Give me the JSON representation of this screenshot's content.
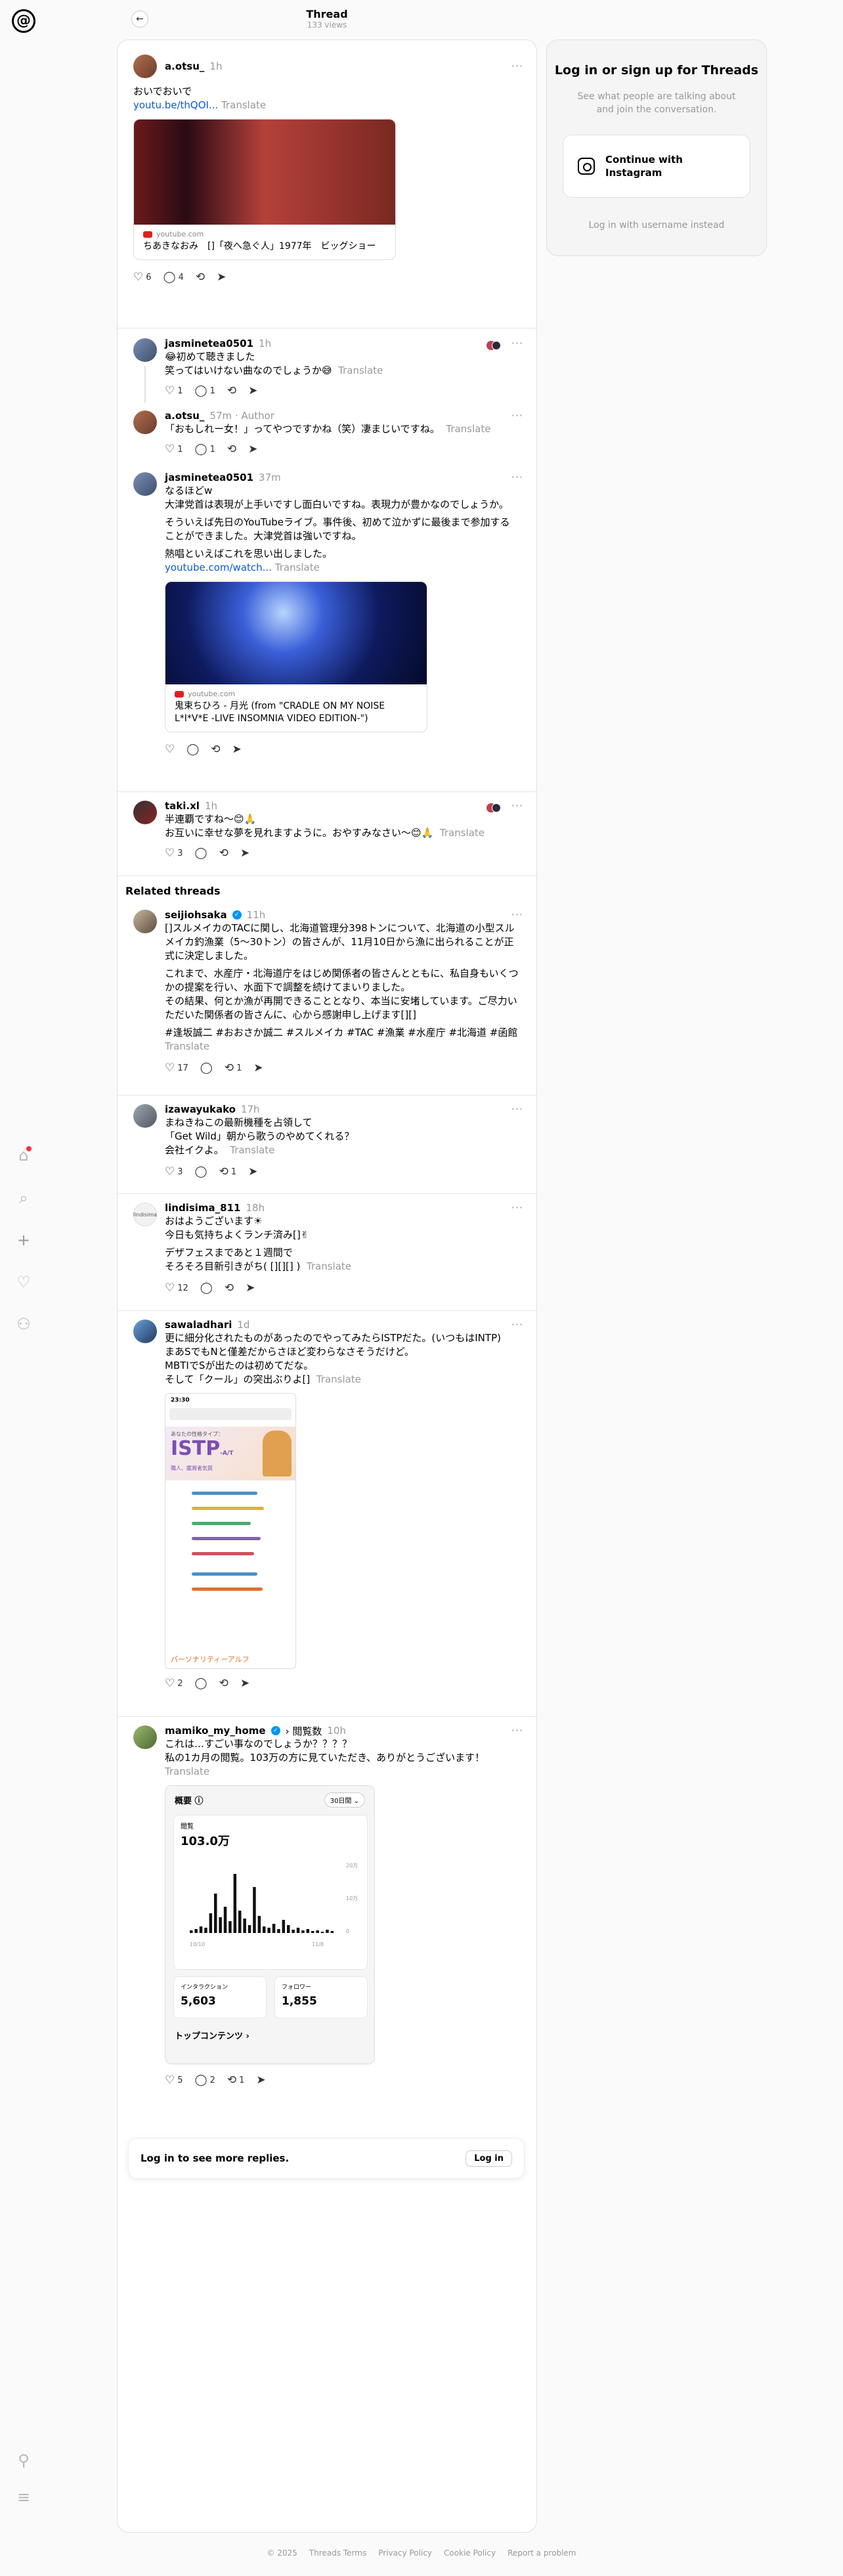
{
  "header": {
    "title": "Thread",
    "views": "133 views"
  },
  "nav": {
    "icons": [
      "home-icon",
      "search-icon",
      "create-icon",
      "heart-icon",
      "profile-icon",
      "pin-icon",
      "menu-icon"
    ]
  },
  "main_post": {
    "author": "a.otsu_",
    "time": "1h",
    "text": "おいでおいで",
    "link": "youtu.be/thQOI...",
    "translate": "Translate",
    "media": {
      "source": "youtube.com",
      "title": "ちあきなおみ　[]「夜へ急ぐ人」1977年　ビッグショー"
    },
    "likes": "6",
    "comments": "4"
  },
  "replies": [
    {
      "author": "jasminetea0501",
      "time": "1h",
      "text": "😂初めて聴きました\n笑ってはいけない曲なのでしょうか😅",
      "translate": "Translate",
      "likes": "1",
      "comments": "1"
    },
    {
      "author": "a.otsu_",
      "time": "57m",
      "tag": "· Author",
      "text": "「おもしれー女！」ってやつですかね（笑）凄まじいですね。",
      "translate": "Translate",
      "likes": "1",
      "comments": "1"
    },
    {
      "author": "jasminetea0501",
      "time": "37m",
      "p1": "なるほどw\n大津党首は表現が上手いですし面白いですね。表現力が豊かなのでしょうか。",
      "p2": "そういえば先日のYouTubeライブ。事件後、初めて泣かずに最後まで参加することができました。大津党首は強いですね。",
      "p3": "熱唱といえばこれを思い出しました。",
      "link": "youtube.com/watch...",
      "translate": "Translate",
      "media": {
        "source": "youtube.com",
        "title": "鬼束ちひろ - 月光 (from \"CRADLE ON MY NOISE L*I*V*E -LIVE INSOMNIA VIDEO EDITION-\")"
      }
    },
    {
      "author": "taki.xl",
      "time": "1h",
      "text": "半連覇ですね〜😊🙏\nお互いに幸せな夢を見れますように。おやすみなさい〜😊🙏",
      "translate": "Translate",
      "likes": "3"
    }
  ],
  "related": {
    "heading": "Related threads",
    "posts": [
      {
        "author": "seijiohsaka",
        "time": "11h",
        "p1": "[]スルメイカのTACに関し、北海道管理分398トンについて、北海道の小型スルメイカ釣漁業（5〜30トン）の皆さんが、11月10日から漁に出られることが正式に決定しました。",
        "p2": "これまで、水産庁・北海道庁をはじめ関係者の皆さんとともに、私自身もいくつかの提案を行い、水面下で調整を続けてまいりました。\nその結果、何とか漁が再開できることとなり、本当に安堵しています。ご尽力いただいた関係者の皆さんに、心から感謝申し上げます[][]",
        "p3": "#逢坂誠二 #おおさか誠二 #スルメイカ #TAC #漁業 #水産庁 #北海道 #函館",
        "translate": "Translate",
        "likes": "17",
        "reposts": "1"
      },
      {
        "author": "izawayukako",
        "time": "17h",
        "text": "まねきねこの最新機種を占領して\n「Get Wild」朝から歌うのやめてくれる？\n会社イクよ。",
        "translate": "Translate",
        "likes": "3",
        "reposts": "1"
      },
      {
        "author": "lindisima_811",
        "time": "18h",
        "avatar_text": "lindisima",
        "p1": "おはようございます☀\n今日も気持ちよくランチ済み[]✌",
        "p2": "デザフェスまであと１週間で\nそろそろ目新引きがち( [][][] )",
        "translate": "Translate",
        "likes": "12"
      },
      {
        "author": "sawaladhari",
        "time": "1d",
        "text": "更に細分化されたものがあったのでやってみたらISTPだた。(いつもはINTP)\nまあSでもNと僅差だからさほど変わらなさそうだけど。\nMBTIでSが出たのは初めてだな。\nそして「クール」の突出ぶりよ[]",
        "translate": "Translate",
        "shot": {
          "time": "23:30",
          "type_label": "あなたの性格タイプ：",
          "type": "ISTP",
          "type_sub": "-A/T",
          "role": "職人、鑑賞者気質",
          "footer": "パーソナリティーアルフ"
        },
        "likes": "2"
      },
      {
        "author": "mamiko_my_home",
        "time": "10h",
        "badge": "› 閲覧数",
        "text": "これは…すごい事なのでしょうか？？？？\n私の1カ月の閲覧。103万の方に見ていただき、ありがとうございます！",
        "translate": "Translate",
        "insights": {
          "title": "概要",
          "range": "30日間",
          "views_label": "閲覧",
          "views": "103.0万",
          "ticks": [
            "20万",
            "10万",
            "0"
          ],
          "dates": [
            "10/10",
            "11/8"
          ],
          "interactions_label": "インタラクション",
          "interactions": "5,603",
          "followers_label": "フォロワー",
          "followers": "1,855",
          "top_content": "トップコンテンツ"
        },
        "likes": "5",
        "comments": "2",
        "reposts": "1"
      }
    ]
  },
  "reply_prompt": {
    "label": "Log in to see more replies.",
    "button": "Log in"
  },
  "login_card": {
    "heading": "Log in or sign up for Threads",
    "sub": "See what people are talking about and join the conversation.",
    "button": "Continue with Instagram",
    "alt": "Log in with username instead"
  },
  "footer": [
    "© 2025",
    "Threads Terms",
    "Privacy Policy",
    "Cookie Policy",
    "Report a problem"
  ],
  "colors": {
    "accent": "#0095f6",
    "link": "#0a5bd8",
    "notification": "#ff3040"
  }
}
